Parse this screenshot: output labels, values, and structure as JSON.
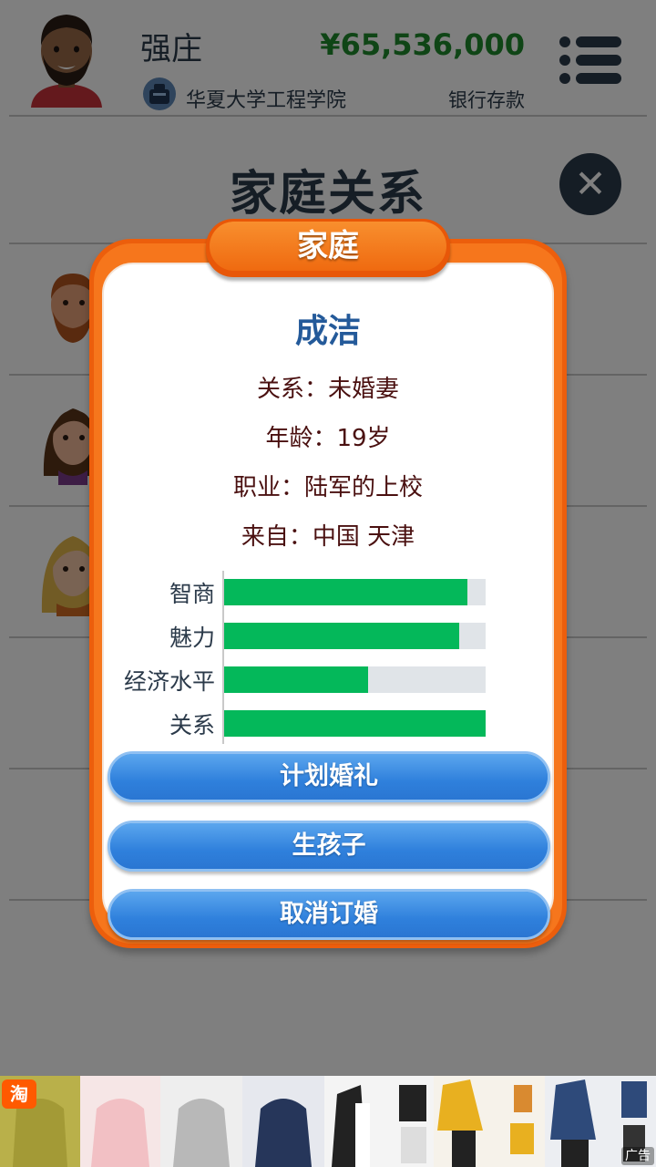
{
  "header": {
    "player_name": "强庄",
    "school": "华夏大学工程学院",
    "money": "¥65,536,000",
    "money_label": "银行存款"
  },
  "page": {
    "title": "家庭关系"
  },
  "dialog": {
    "title": "家庭",
    "person_name": "成洁",
    "info": [
      "关系：未婚妻",
      "年龄：19岁",
      "职业：陆军的上校",
      "来自：中国 天津"
    ],
    "stats": [
      {
        "label": "智商",
        "fraction": 0.93
      },
      {
        "label": "魅力",
        "fraction": 0.9
      },
      {
        "label": "经济水平",
        "fraction": 0.55
      },
      {
        "label": "关系",
        "fraction": 1.0
      }
    ],
    "buttons": [
      "计划婚礼",
      "生孩子",
      "取消订婚"
    ]
  },
  "ad": {
    "badge": "淘",
    "label": "广告"
  },
  "colors": {
    "money": "#1f8a2c",
    "dialog_frame": "#ec5e0c",
    "stat_fill": "#04b85a",
    "button": "#2f7ed8"
  }
}
